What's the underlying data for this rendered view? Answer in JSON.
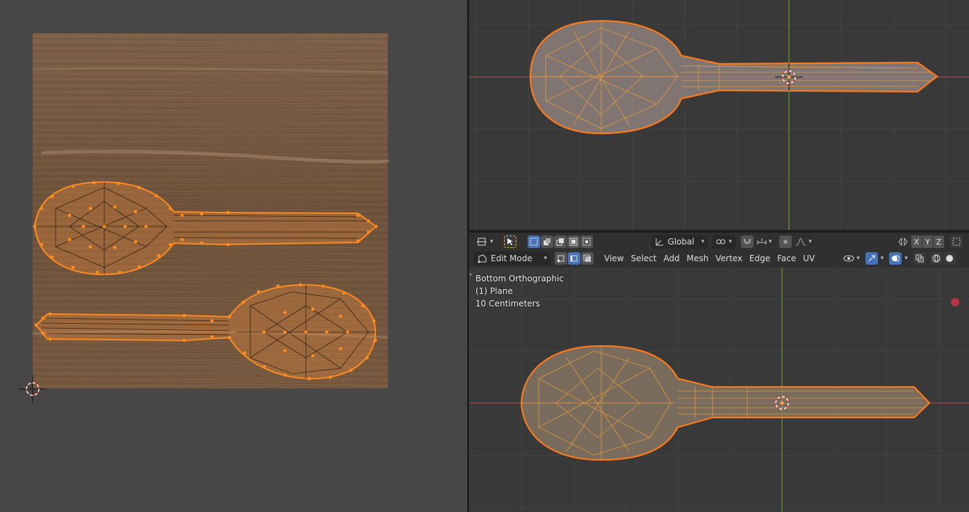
{
  "header": {
    "transform_orientation": "Global",
    "mode": "Edit Mode",
    "menus": [
      "View",
      "Select",
      "Add",
      "Mesh",
      "Vertex",
      "Edge",
      "Face",
      "UV"
    ],
    "axes": [
      "X",
      "Y",
      "Z"
    ]
  },
  "viewport_info": {
    "view_name": "Bottom Orthographic",
    "object": "(1) Plane",
    "scale": "10 Centimeters"
  },
  "colors": {
    "selection": "#ff8a1f",
    "wood": "#7a5c43",
    "active_blue": "#4772b3",
    "x_axis": "#a8434b",
    "y_axis": "#6a9a2a"
  },
  "icons": {
    "cursor": "3d-cursor-icon",
    "select_tool": "select-arrow-icon"
  }
}
